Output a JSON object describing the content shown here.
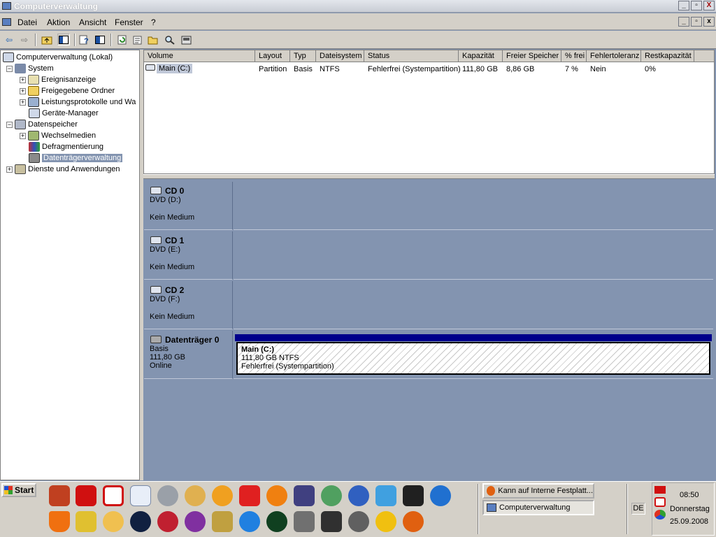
{
  "window": {
    "title": "Computerverwaltung",
    "controls": [
      "_",
      "▫",
      "X"
    ]
  },
  "menu": [
    "Datei",
    "Aktion",
    "Ansicht",
    "Fenster",
    "?"
  ],
  "tree": {
    "root": "Computerverwaltung (Lokal)",
    "system": "System",
    "ereignis": "Ereignisanzeige",
    "freigegeben": "Freigegebene Ordner",
    "leistung": "Leistungsprotokolle und Wa",
    "geraete": "Geräte-Manager",
    "datenspeicher": "Datenspeicher",
    "wechsel": "Wechselmedien",
    "defrag": "Defragmentierung",
    "datentraeger": "Datenträgerverwaltung",
    "dienste": "Dienste und Anwendungen"
  },
  "volume_list": {
    "columns": [
      "Volume",
      "Layout",
      "Typ",
      "Dateisystem",
      "Status",
      "Kapazität",
      "Freier Speicher",
      "% frei",
      "Fehlertoleranz",
      "Restkapazität"
    ],
    "rows": [
      [
        "Main (C:)",
        "Partition",
        "Basis",
        "NTFS",
        "Fehlerfrei (Systempartition)",
        "111,80 GB",
        "8,86 GB",
        "7 %",
        "Nein",
        "0%"
      ]
    ]
  },
  "disks": [
    {
      "name": "CD 0",
      "type": "DVD (D:)",
      "line3": "",
      "state": "Kein Medium"
    },
    {
      "name": "CD 1",
      "type": "DVD (E:)",
      "line3": "",
      "state": "Kein Medium"
    },
    {
      "name": "CD 2",
      "type": "DVD (F:)",
      "line3": "",
      "state": "Kein Medium"
    },
    {
      "name": "Datenträger 0",
      "type": "Basis",
      "line3": "111,80 GB",
      "state": "Online"
    }
  ],
  "partition": {
    "title": "Main  (C:)",
    "size": "111,80 GB NTFS",
    "status": "Fehlerfrei (Systempartition)"
  },
  "taskbar": {
    "start": "Start",
    "tasks": [
      "Kann auf Interne Festplatt...",
      "Computerverwaltung"
    ],
    "lang": "DE",
    "time": "08:50",
    "day": "Donnerstag",
    "date": "25.09.2008"
  },
  "colors": {
    "desktop": "#8394b0",
    "partition_bar": "#00008b",
    "chrome": "#d4d0c8"
  }
}
